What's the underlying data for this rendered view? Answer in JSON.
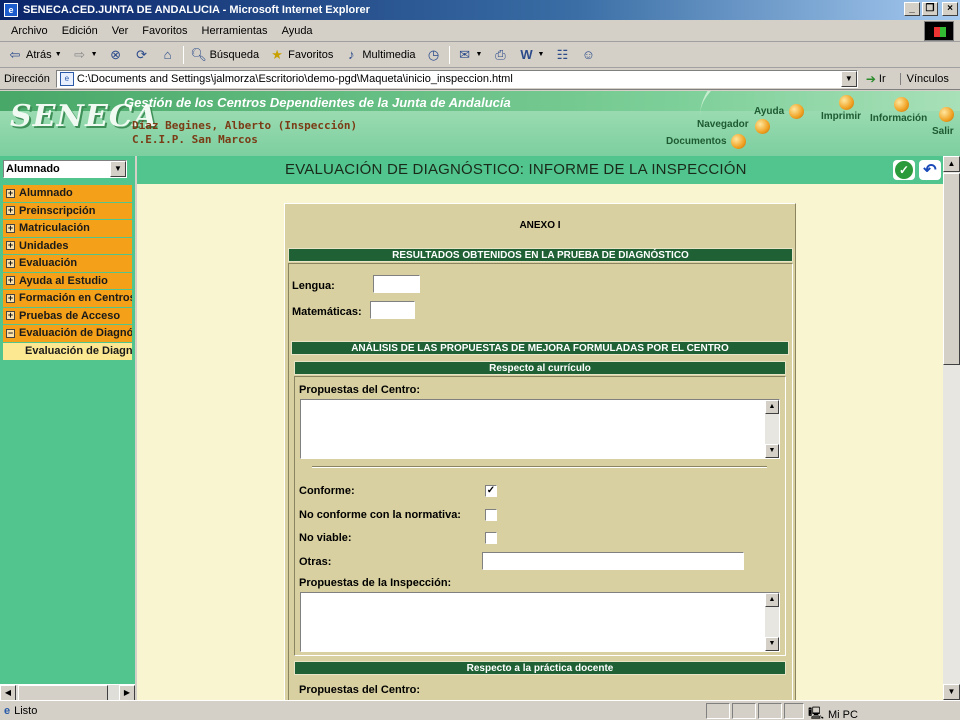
{
  "window": {
    "title": "SENECA.CED.JUNTA DE ANDALUCIA - Microsoft Internet Explorer",
    "minimize": "_",
    "maximize": "❐",
    "close": "×"
  },
  "menu": [
    "Archivo",
    "Edición",
    "Ver",
    "Favoritos",
    "Herramientas",
    "Ayuda"
  ],
  "toolbar": {
    "back": "Atrás",
    "search": "Búsqueda",
    "favorites": "Favoritos",
    "media": "Multimedia"
  },
  "address": {
    "label": "Dirección",
    "url": "C:\\Documents and Settings\\jalmorza\\Escritorio\\demo-pgd\\Maqueta\\inicio_inspeccion.html",
    "go": "Ir",
    "links": "Vínculos"
  },
  "banner": {
    "logo": "SENECA",
    "gestion": "Gestión de los Centros Dependientes de  la Junta de Andalucía",
    "user": "Díaz Begines, Alberto (Inspección)",
    "school": "C.E.I.P. San Marcos",
    "links": {
      "ayuda": "Ayuda",
      "navegador": "Navegador",
      "documentos": "Documentos",
      "imprimir": "Imprimir",
      "informacion": "Información",
      "salir": "Salir"
    }
  },
  "sidebar": {
    "profile": "Alumnado",
    "items": [
      {
        "label": "Alumnado",
        "expander": "+"
      },
      {
        "label": "Preinscripción",
        "expander": "+"
      },
      {
        "label": "Matriculación",
        "expander": "+"
      },
      {
        "label": "Unidades",
        "expander": "+"
      },
      {
        "label": "Evaluación",
        "expander": "+"
      },
      {
        "label": "Ayuda al Estudio",
        "expander": "+"
      },
      {
        "label": "Formación en Centros",
        "expander": "+"
      },
      {
        "label": "Pruebas de Acceso",
        "expander": "+"
      },
      {
        "label": "Evaluación de Diagnóstico",
        "expander": "−"
      }
    ],
    "subitem": "Evaluación de Diagnóstico"
  },
  "page": {
    "title": "EVALUACIÓN DE DIAGNÓSTICO: INFORME DE LA INSPECCIÓN"
  },
  "form": {
    "annex": "ANEXO I",
    "results_header": "RESULTADOS OBTENIDOS EN LA PRUEBA DE DIAGNÓSTICO",
    "lengua_label": "Lengua:",
    "lengua_value": "",
    "matematicas_label": "Matemáticas:",
    "matematicas_value": "",
    "analysis_header": "ANÁLISIS DE LAS PROPUESTAS DE MEJORA FORMULADAS POR EL CENTRO",
    "curriculo_header": "Respecto al currículo",
    "propuestas_centro_label": "Propuestas del Centro:",
    "conforme_label": "Conforme:",
    "conforme_checked": true,
    "no_conforme_label": "No conforme con la normativa:",
    "no_conforme_checked": false,
    "no_viable_label": "No viable:",
    "no_viable_checked": false,
    "otras_label": "Otras:",
    "otras_value": "",
    "propuestas_inspeccion_label": "Propuestas de la Inspección:",
    "practica_header": "Respecto a la práctica docente",
    "propuestas_centro2_label": "Propuestas del Centro:",
    "check_mark": "✓"
  },
  "status": {
    "text": "Listo",
    "zone": "Mi PC"
  }
}
